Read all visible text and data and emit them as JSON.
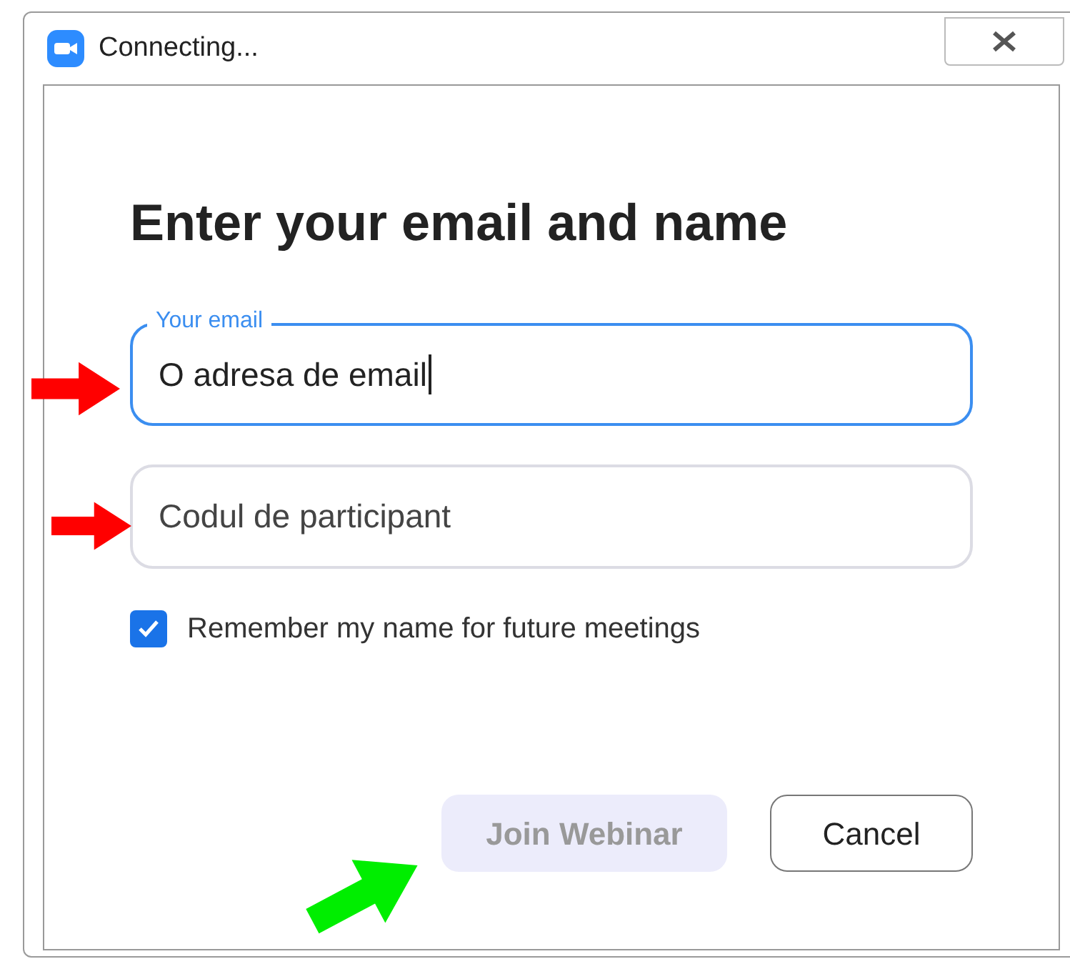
{
  "window": {
    "title": "Connecting..."
  },
  "heading": "Enter your email and name",
  "email_field": {
    "label": "Your email",
    "value": "O adresa de email",
    "focused": true
  },
  "name_field": {
    "placeholder": "Codul de participant"
  },
  "remember": {
    "label": "Remember my name for future meetings",
    "checked": true
  },
  "buttons": [
    {
      "label": "Join Webinar",
      "kind": "primary",
      "disabled": true
    },
    {
      "label": "Cancel",
      "kind": "secondary",
      "disabled": false
    }
  ]
}
